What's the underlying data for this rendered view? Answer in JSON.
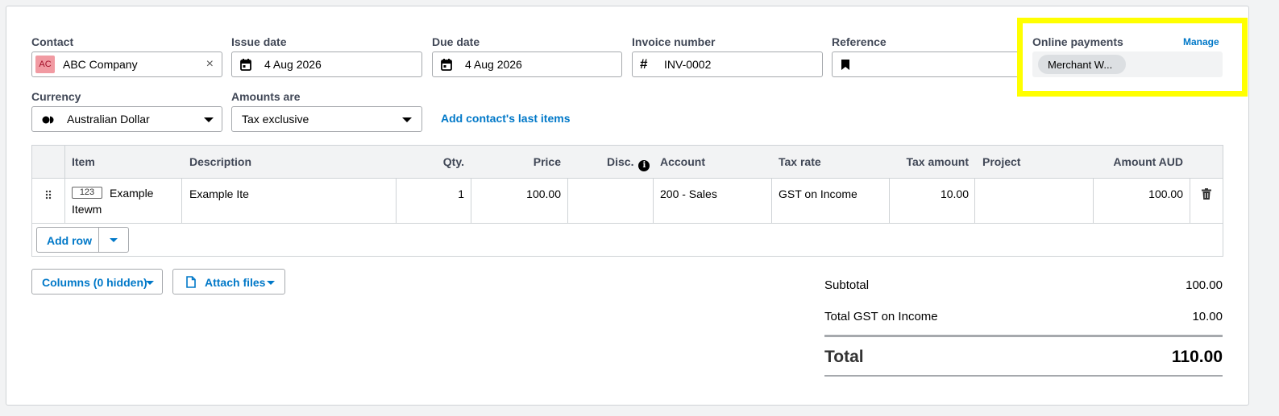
{
  "contact": {
    "label": "Contact",
    "avatar": "AC",
    "value": "ABC Company",
    "clear_icon": "×"
  },
  "issue_date": {
    "label": "Issue date",
    "value": "4 Aug 2026",
    "icon": "calendar-icon"
  },
  "due_date": {
    "label": "Due date",
    "value": "4 Aug 2026",
    "icon": "calendar-icon"
  },
  "invoice_number": {
    "label": "Invoice number",
    "value": "INV-0002",
    "icon": "hash-icon",
    "glyph": "#"
  },
  "reference": {
    "label": "Reference",
    "value": "",
    "icon": "bookmark-icon"
  },
  "online_payments": {
    "label": "Online payments",
    "manage": "Manage",
    "chip": "Merchant W...",
    "highlight_color": "#ffff00"
  },
  "currency": {
    "label": "Currency",
    "value": "Australian Dollar"
  },
  "amounts_are": {
    "label": "Amounts are",
    "value": "Tax exclusive"
  },
  "add_last_items": "Add contact's last items",
  "table": {
    "headers": {
      "item": "Item",
      "description": "Description",
      "qty": "Qty.",
      "price": "Price",
      "disc": "Disc.",
      "account": "Account",
      "tax_rate": "Tax rate",
      "tax_amount": "Tax amount",
      "project": "Project",
      "amount": "Amount AUD"
    },
    "rows": [
      {
        "item_code": "123",
        "item_name_1": "Example",
        "item_name_2": "Itewm",
        "description": "Example Ite",
        "qty": "1",
        "price": "100.00",
        "disc": "",
        "account": "200 - Sales",
        "tax_rate": "GST on Income",
        "tax_amount": "10.00",
        "project": "",
        "amount": "100.00"
      }
    ],
    "add_row": "Add row"
  },
  "columns_button": "Columns (0 hidden)",
  "attach_button": "Attach files",
  "totals": {
    "subtotal_label": "Subtotal",
    "subtotal_value": "100.00",
    "gst_label": "Total GST on Income",
    "gst_value": "10.00",
    "total_label": "Total",
    "total_value": "110.00"
  },
  "colors": {
    "accent": "#0078c8",
    "avatar_bg": "#f19aa2",
    "highlight": "#ffff00"
  }
}
